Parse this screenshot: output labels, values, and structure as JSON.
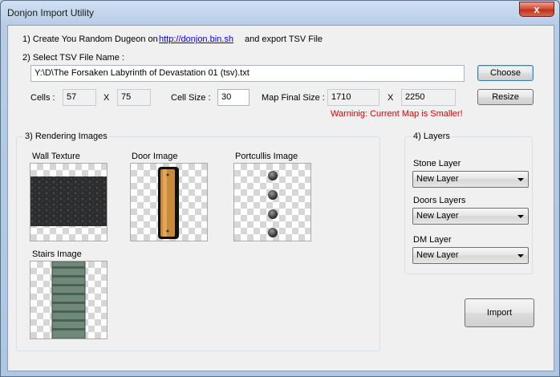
{
  "window": {
    "title": "Donjon Import Utility",
    "close_glyph": "x"
  },
  "step1": {
    "text": "1) Create You Random Dugeon on",
    "link": "http://donjon.bin.sh",
    "suffix": "and export TSV File"
  },
  "step2": {
    "label": "2) Select TSV File Name :",
    "file_path": "Y:\\D\\The Forsaken Labyrinth of Devastation 01 (tsv).txt",
    "choose_button": "Choose"
  },
  "cells": {
    "label": "Cells :",
    "width": "57",
    "sep": "X",
    "height": "75"
  },
  "cell_size": {
    "label": "Cell Size :",
    "value": "30"
  },
  "map_final_size": {
    "label": "Map Final Size :",
    "width": "1710",
    "sep": "X",
    "height": "2250"
  },
  "warning": "Warninig: Current Map is Smaller!",
  "resize_button": "Resize",
  "rendering": {
    "title": "3) Rendering Images",
    "wall_label": "Wall Texture",
    "door_label": "Door Image",
    "portcullis_label": "Portcullis Image",
    "stairs_label": "Stairs Image"
  },
  "layers": {
    "title": "4) Layers",
    "stone_label": "Stone Layer",
    "stone_value": "New Layer",
    "doors_label": "Doors Layers",
    "doors_value": "New Layer",
    "dm_label": "DM Layer",
    "dm_value": "New Layer"
  },
  "import_button": "Import"
}
